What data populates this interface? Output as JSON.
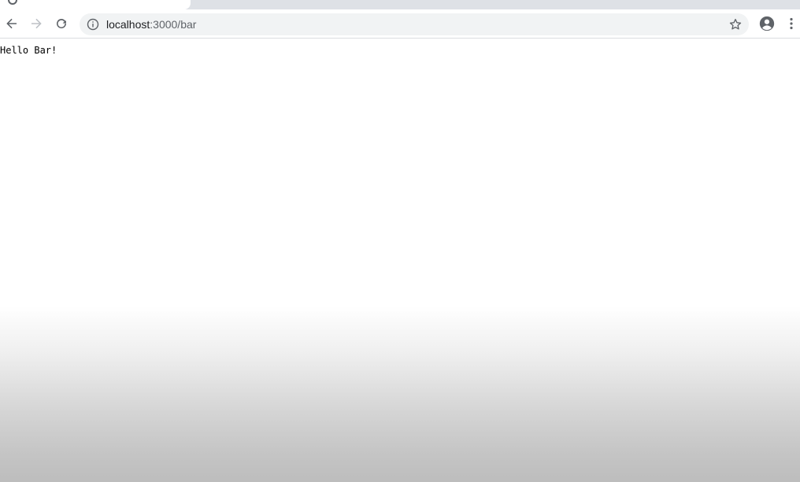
{
  "browser": {
    "address_bar": {
      "host": "localhost",
      "path": ":3000/bar"
    },
    "icons": {
      "back": "back-arrow-icon",
      "forward": "forward-arrow-icon",
      "reload": "reload-icon",
      "site_info": "info-icon",
      "bookmark": "star-icon",
      "profile": "account-circle-icon",
      "menu": "kebab-menu-icon"
    },
    "colors": {
      "toolbar_bg": "#ffffff",
      "omnibox_bg": "#f1f3f4",
      "icon": "#5f6368",
      "forward_disabled": "#bdc1c6",
      "tabstrip_bg": "#dee1e6"
    }
  },
  "page": {
    "body_text": "Hello Bar!"
  }
}
